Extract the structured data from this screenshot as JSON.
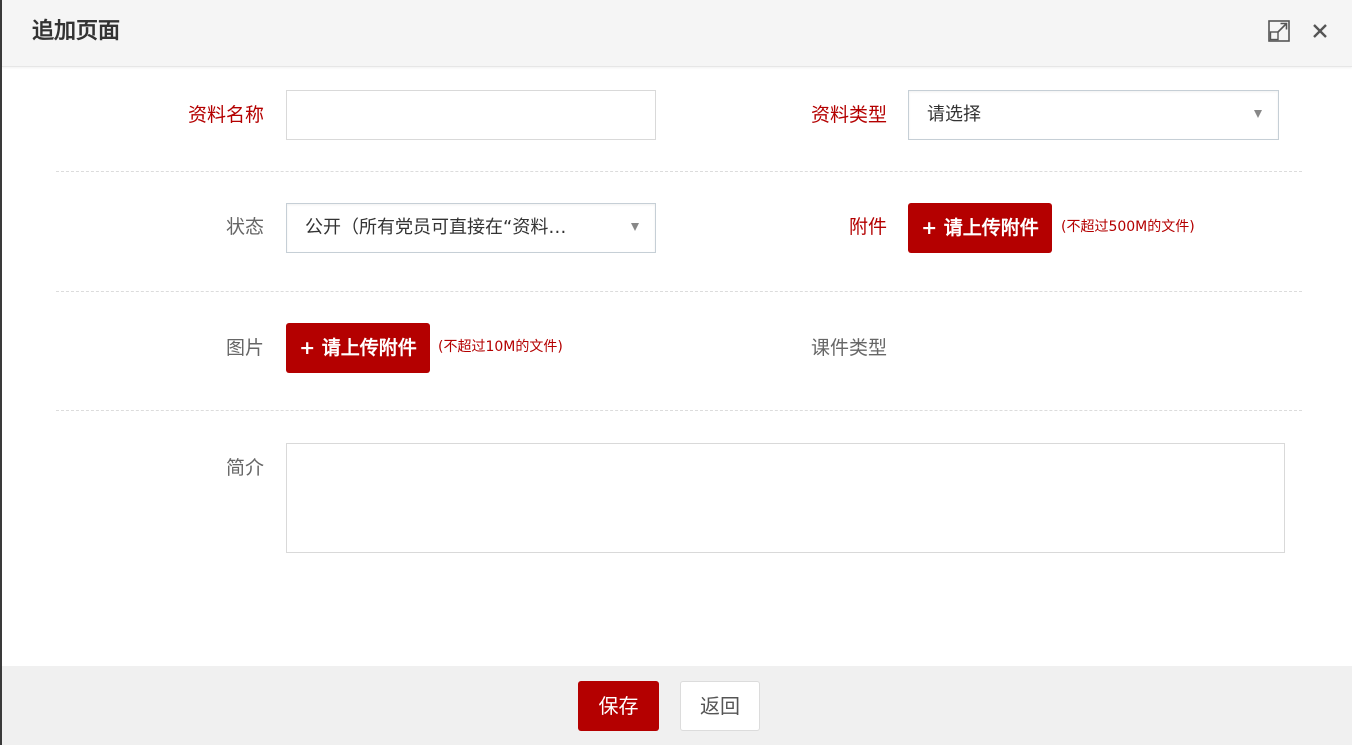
{
  "dialog": {
    "title": "追加页面"
  },
  "form": {
    "name_label": "资料名称",
    "name_value": "",
    "type_label": "资料类型",
    "type_selected": "请选择",
    "status_label": "状态",
    "status_selected": "公开（所有党员可直接在“资料…",
    "attachment_label": "附件",
    "attachment_button": "+ 请上传附件",
    "attachment_hint": "(不超过500M的文件)",
    "image_label": "图片",
    "image_button": "+ 请上传附件",
    "image_hint": "(不超过10M的文件)",
    "course_type_label": "课件类型",
    "intro_label": "简介",
    "intro_value": ""
  },
  "footer": {
    "save_label": "保存",
    "back_label": "返回"
  },
  "colors": {
    "accent": "#b40000",
    "header_bg": "#f5f5f5",
    "footer_bg": "#f0f0f0"
  },
  "icons": {
    "maximize": "maximize-icon",
    "close": "close-icon"
  }
}
